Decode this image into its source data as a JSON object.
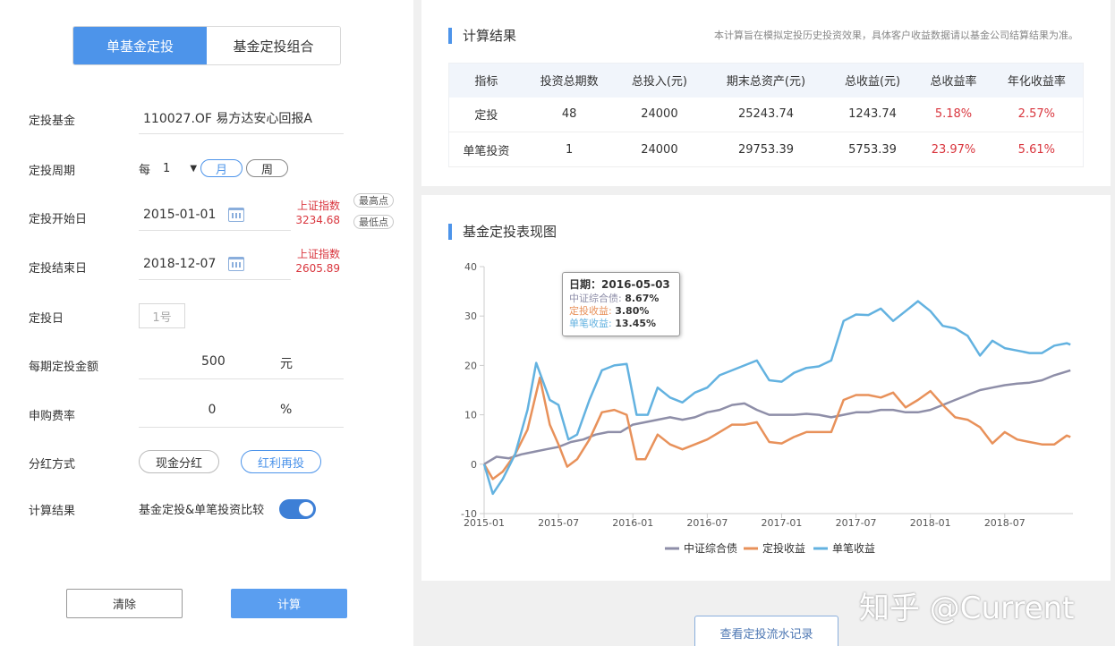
{
  "tabs": [
    {
      "label": "单基金定投",
      "active": true
    },
    {
      "label": "基金定投组合",
      "active": false
    }
  ],
  "form": {
    "fund_label": "定投基金",
    "fund_value": "110027.OF 易方达安心回报A",
    "period_label": "定投周期",
    "period_prefix": "每",
    "period_count": "1",
    "period_month": "月",
    "period_week": "周",
    "start_label": "定投开始日",
    "start_date": "2015-01-01",
    "start_index_name": "上证指数",
    "start_index_value": "3234.68",
    "badge_high": "最高点",
    "badge_low": "最低点",
    "end_label": "定投结束日",
    "end_date": "2018-12-07",
    "end_index_name": "上证指数",
    "end_index_value": "2605.89",
    "day_label": "定投日",
    "day_placeholder": "1号",
    "amount_label": "每期定投金额",
    "amount_value": "500",
    "amount_unit": "元",
    "fee_label": "申购费率",
    "fee_value": "0",
    "fee_unit": "%",
    "dividend_label": "分红方式",
    "dividend_cash": "现金分红",
    "dividend_reinvest": "红利再投",
    "result_label": "计算结果",
    "compare_text": "基金定投&单笔投资比较",
    "clear_button": "清除",
    "calc_button": "计算"
  },
  "results": {
    "title": "计算结果",
    "disclaimer": "本计算旨在模拟定投历史投资效果，具体客户收益数据请以基金公司结算结果为准。",
    "headers": [
      "指标",
      "投资总期数",
      "总投入(元)",
      "期末总资产(元)",
      "总收益(元)",
      "总收益率",
      "年化收益率"
    ],
    "rows": [
      [
        "定投",
        "48",
        "24000",
        "25243.74",
        "1243.74",
        "5.18%",
        "2.57%"
      ],
      [
        "单笔投资",
        "1",
        "24000",
        "29753.39",
        "5753.39",
        "23.97%",
        "5.61%"
      ]
    ]
  },
  "chart_panel": {
    "title": "基金定投表现图",
    "view_button": "查看定投流水记录"
  },
  "tooltip": {
    "date_label": "日期：",
    "date": "2016-05-03",
    "s1_label": "中证综合债: ",
    "s1_value": "8.67%",
    "s2_label": "定投收益: ",
    "s2_value": "3.80%",
    "s3_label": "单笔收益: ",
    "s3_value": "13.45%"
  },
  "colors": {
    "bond": "#8e8ea8",
    "dca": "#e8915a",
    "single": "#63b2e0",
    "accent": "#4d94ea",
    "red": "#d9363e"
  },
  "watermark": "知乎 @Current",
  "chart_data": {
    "type": "line",
    "x_ticks": [
      "2015-01",
      "2015-07",
      "2016-01",
      "2016-07",
      "2017-01",
      "2017-07",
      "2018-01",
      "2018-07"
    ],
    "y_ticks": [
      -10,
      0,
      10,
      20,
      30,
      40
    ],
    "ylim": [
      -10,
      40
    ],
    "xlim_months": [
      0,
      47.5
    ],
    "series": [
      {
        "name": "中证综合债",
        "color": "#8e8ea8",
        "x": [
          0,
          1,
          2,
          3,
          4,
          5,
          6,
          7,
          8,
          9,
          10,
          11,
          12,
          13,
          14,
          15,
          16,
          17,
          18,
          19,
          20,
          21,
          22,
          23,
          24,
          25,
          26,
          27,
          28,
          29,
          30,
          31,
          32,
          33,
          34,
          35,
          36,
          37,
          38,
          39,
          40,
          41,
          42,
          43,
          44,
          45,
          46,
          47.3
        ],
        "y": [
          0,
          1.5,
          1.2,
          2,
          2.5,
          3,
          3.5,
          4.5,
          5,
          6,
          6.5,
          6.5,
          8,
          8.5,
          9,
          9.5,
          9,
          9.5,
          10.5,
          11,
          12,
          12.3,
          11,
          10,
          10,
          10,
          10.2,
          10,
          9.5,
          10,
          10.5,
          10.5,
          11,
          11,
          10.5,
          10.5,
          11,
          12,
          13,
          14,
          15,
          15.5,
          16,
          16.3,
          16.5,
          17,
          18,
          19
        ]
      },
      {
        "name": "定投收益",
        "color": "#e8915a",
        "x": [
          0,
          0.7,
          1.5,
          2.5,
          3.5,
          4.5,
          5.3,
          6,
          6.7,
          7.5,
          8.5,
          9.5,
          10.5,
          11.5,
          12.3,
          13,
          14,
          15,
          16,
          17,
          18,
          19,
          20,
          21,
          22,
          23,
          24,
          25,
          26,
          27,
          28,
          29,
          30,
          31,
          32,
          33,
          34,
          35,
          36,
          37,
          38,
          39,
          40,
          41,
          42,
          43,
          44,
          45,
          46,
          47,
          47.3
        ],
        "y": [
          0,
          -3,
          -1.5,
          2,
          7,
          17.5,
          8,
          4,
          -0.5,
          1,
          5,
          10.5,
          11,
          10,
          1,
          1,
          6,
          4,
          3,
          4,
          5,
          6.5,
          8,
          8,
          8.5,
          4.5,
          4.2,
          5.5,
          6.5,
          6.5,
          6.5,
          13,
          14,
          14,
          13.5,
          14.5,
          11.5,
          13,
          14.8,
          12,
          9.5,
          9,
          7.5,
          4.2,
          6.5,
          5,
          4.5,
          4,
          4,
          5.8,
          5.5
        ]
      },
      {
        "name": "单笔收益",
        "color": "#63b2e0",
        "x": [
          0,
          0.7,
          1.5,
          2.5,
          3.5,
          4.2,
          5.3,
          6,
          6.8,
          7.5,
          8.5,
          9.5,
          10.5,
          11.5,
          12.3,
          13.2,
          14,
          15,
          16,
          17,
          18,
          19,
          20,
          21,
          22,
          23,
          24,
          25,
          26,
          27,
          28,
          29,
          30,
          31,
          32,
          33,
          34,
          35,
          36,
          37,
          38,
          39,
          40,
          41,
          42,
          43,
          44,
          45,
          46,
          47,
          47.3
        ],
        "y": [
          0,
          -6,
          -3,
          2,
          11,
          20.5,
          13,
          12,
          5,
          6,
          13,
          19,
          20,
          20.3,
          10,
          10,
          15.5,
          13.5,
          12.5,
          14.5,
          15.5,
          18,
          19,
          20,
          21,
          17,
          16.7,
          18.5,
          19.5,
          19.8,
          21,
          29,
          30.3,
          30.2,
          31.5,
          29,
          31,
          33,
          31,
          28,
          27.5,
          26,
          22,
          25,
          23.5,
          23,
          22.5,
          22.5,
          24,
          24.5,
          24.2
        ]
      }
    ],
    "legend": [
      "中证综合债",
      "定投收益",
      "单笔收益"
    ],
    "legend_position": "bottom",
    "grid": false
  }
}
